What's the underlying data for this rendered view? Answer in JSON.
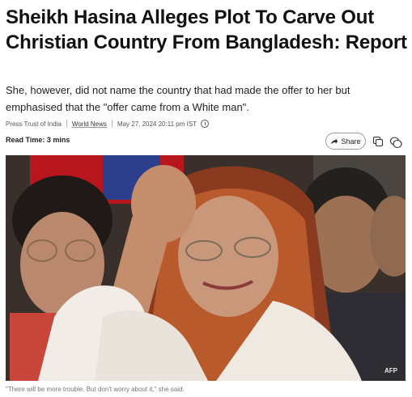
{
  "article": {
    "headline": "Sheikh Hasina Alleges Plot To Carve Out Christian Country From Bangladesh: Report",
    "summary": "She, however, did not name the country that had made the offer to her but emphasised that the \"offer came from a White man\".",
    "source": "Press Trust of India",
    "category": "World News",
    "date": "May 27, 2024 20:11 pm IST",
    "read_time_label": "Read Time:",
    "read_time_value": "3 mins",
    "photo_credit": "AFP",
    "photo_caption": "\"There will be more trouble. But don't worry about it,\" she said."
  },
  "actions": {
    "share_label": "Share"
  },
  "icons": {
    "info": "info-icon",
    "share": "share-arrow-icon",
    "copy": "copy-icon",
    "comment": "comment-icon"
  },
  "colors": {
    "text": "#111111",
    "muted": "#777777",
    "border": "#999999"
  }
}
